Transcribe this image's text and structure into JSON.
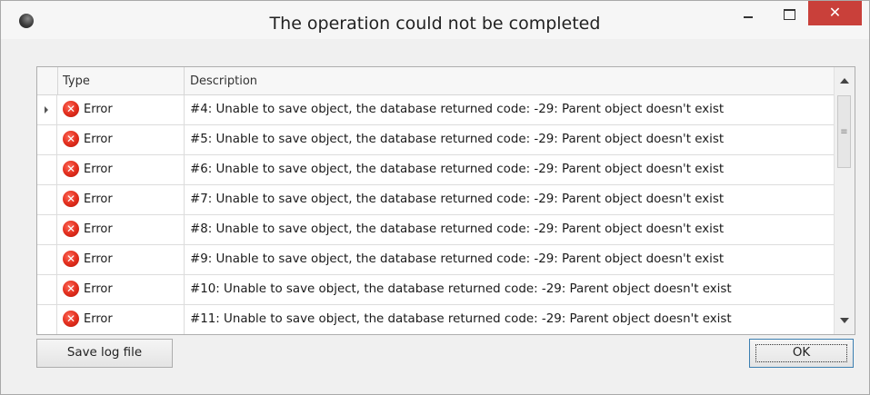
{
  "window": {
    "title": "The operation could not be completed",
    "controls": {
      "minimize": "minimize",
      "maximize": "maximize",
      "close": "✕"
    }
  },
  "grid": {
    "columns": {
      "type": "Type",
      "description": "Description"
    },
    "rows": [
      {
        "type": "Error",
        "description": "#4: Unable to save object, the database returned code: -29: Parent object doesn't exist"
      },
      {
        "type": "Error",
        "description": "#5: Unable to save object, the database returned code: -29: Parent object doesn't exist"
      },
      {
        "type": "Error",
        "description": "#6: Unable to save object, the database returned code: -29: Parent object doesn't exist"
      },
      {
        "type": "Error",
        "description": "#7: Unable to save object, the database returned code: -29: Parent object doesn't exist"
      },
      {
        "type": "Error",
        "description": "#8: Unable to save object, the database returned code: -29: Parent object doesn't exist"
      },
      {
        "type": "Error",
        "description": "#9: Unable to save object, the database returned code: -29: Parent object doesn't exist"
      },
      {
        "type": "Error",
        "description": "#10: Unable to save object, the database returned code: -29: Parent object doesn't exist"
      },
      {
        "type": "Error",
        "description": "#11: Unable to save object, the database returned code: -29: Parent object doesn't exist"
      }
    ],
    "row_icon": "error-icon",
    "row_icon_glyph": "✕"
  },
  "buttons": {
    "save_log": "Save log file",
    "ok": "OK"
  },
  "colors": {
    "close_button": "#c9403a",
    "error_icon": "#e3301f"
  }
}
